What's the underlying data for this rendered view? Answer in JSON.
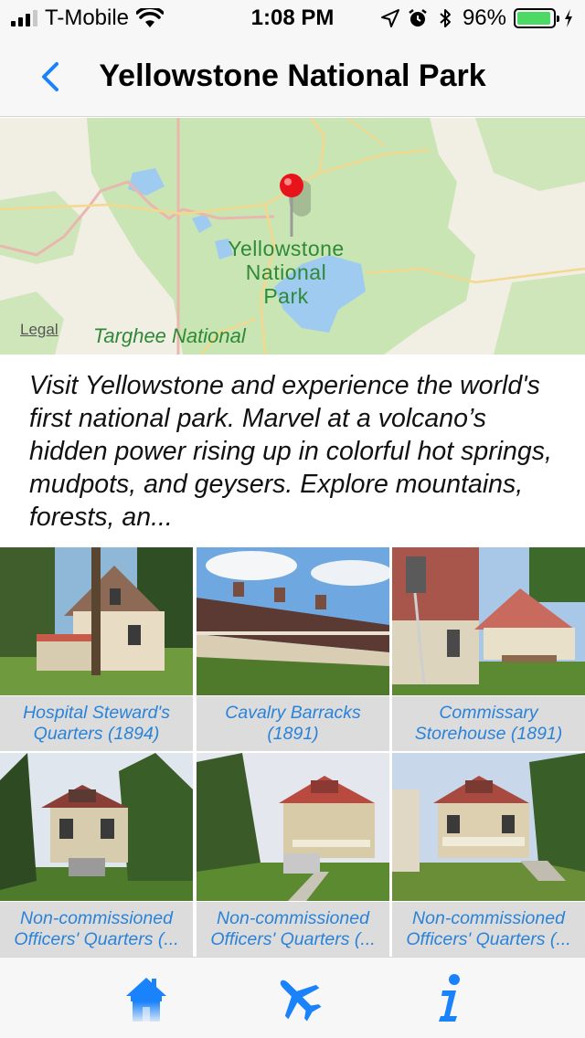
{
  "status_bar": {
    "carrier": "T-Mobile",
    "time": "1:08 PM",
    "battery": "96%",
    "battery_level": 0.96
  },
  "nav": {
    "title": "Yellowstone National Park",
    "back_icon": "chevron-left-icon"
  },
  "map": {
    "park_label_line1": "Yellowstone",
    "park_label_line2": "National",
    "park_label_line3": "Park",
    "forest_label": "Targhee National",
    "legal": "Legal"
  },
  "description": "Visit Yellowstone and experience the world's first national park. Marvel at a volcano’s hidden power rising up in colorful hot springs, mudpots, and geysers. Explore mountains, forests, an...",
  "sites": [
    {
      "line1": "Hospital Steward's",
      "line2": "Quarters  (1894)"
    },
    {
      "line1": "Cavalry Barracks",
      "line2": "(1891)"
    },
    {
      "line1": "Commissary",
      "line2": "Storehouse  (1891)"
    },
    {
      "line1": "Non-commissioned",
      "line2": "Officers' Quarters  (..."
    },
    {
      "line1": "Non-commissioned",
      "line2": "Officers' Quarters  (..."
    },
    {
      "line1": "Non-commissioned",
      "line2": "Officers' Quarters  (..."
    }
  ],
  "tabs": [
    {
      "icon": "home-icon"
    },
    {
      "icon": "airplane-icon"
    },
    {
      "icon": "info-icon"
    }
  ],
  "colors": {
    "accent": "#1a82fb",
    "caption_text": "#2a83d8",
    "caption_bg": "#dcdcdc",
    "map_park_green": "#c9e5b4",
    "pin_red": "#e8141c"
  }
}
